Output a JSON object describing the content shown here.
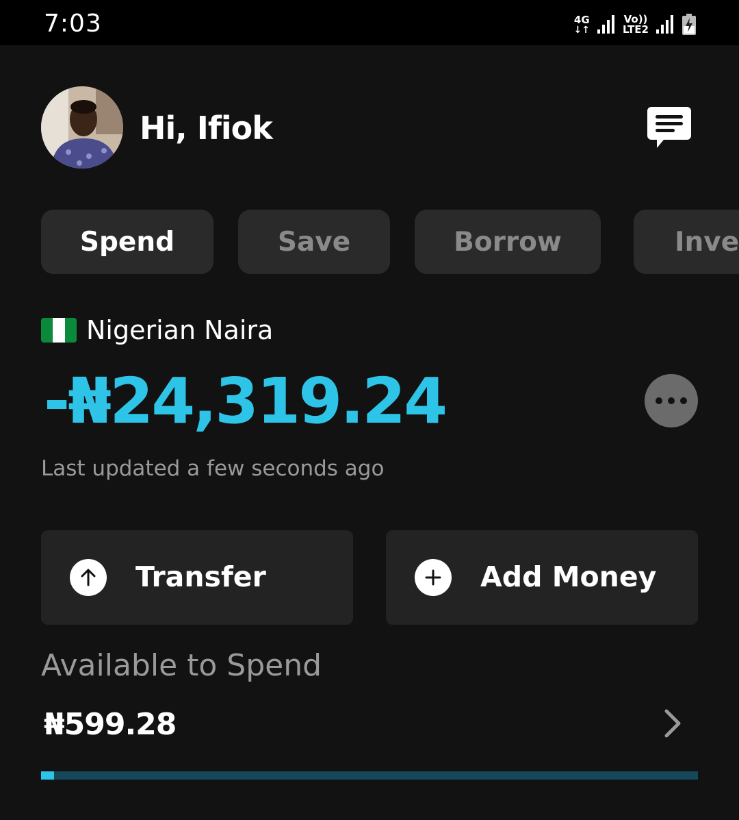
{
  "status_bar": {
    "time": "7:03",
    "network1": "4G",
    "network2_line1": "Vo))",
    "network2_line2": "LTE2"
  },
  "header": {
    "greeting": "Hi, Ifiok"
  },
  "tabs": [
    {
      "label": "Spend",
      "active": true
    },
    {
      "label": "Save",
      "active": false
    },
    {
      "label": "Borrow",
      "active": false
    },
    {
      "label": "Invest",
      "active": false
    }
  ],
  "account": {
    "flag": "nigeria-flag-icon",
    "currency_name": "Nigerian Naira",
    "balance": "-₦24,319.24",
    "last_updated": "Last updated a few seconds ago"
  },
  "actions": {
    "transfer_label": "Transfer",
    "add_money_label": "Add Money"
  },
  "available": {
    "title": "Available to Spend",
    "amount": "₦599.28",
    "progress_fraction": 0.02
  },
  "colors": {
    "accent": "#2ec4e8",
    "background": "#121212",
    "card": "#232323"
  }
}
